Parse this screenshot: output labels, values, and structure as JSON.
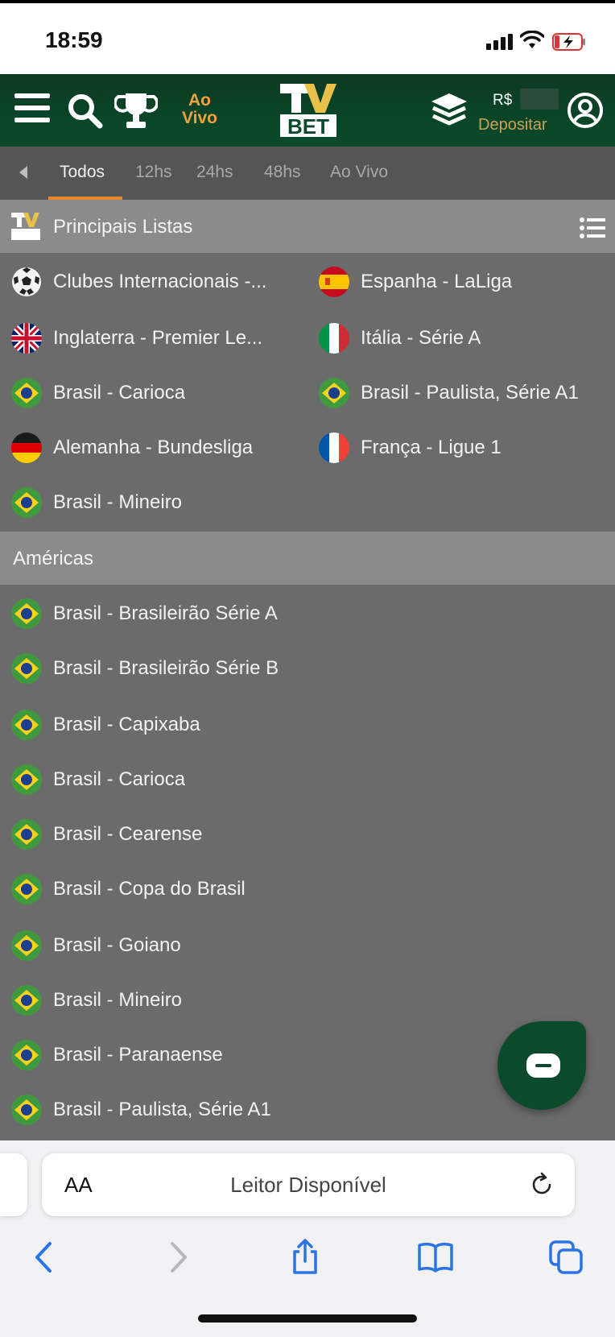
{
  "status_bar": {
    "time": "18:59"
  },
  "header": {
    "live_label": "Ao Vivo",
    "logo_text_top": "TV",
    "logo_text_bottom": "BET",
    "currency": "R$",
    "deposit_label": "Depositar"
  },
  "tabs": [
    {
      "label": "Todos",
      "active": true
    },
    {
      "label": "12hs",
      "active": false
    },
    {
      "label": "24hs",
      "active": false
    },
    {
      "label": "48hs",
      "active": false
    },
    {
      "label": "Ao Vivo",
      "active": false
    }
  ],
  "main_lists": {
    "title": "Principais Listas",
    "items": [
      {
        "label": "Clubes Internacionais -...",
        "icon": "soccer-ball-icon"
      },
      {
        "label": "Espanha - LaLiga",
        "icon": "spain-flag-icon"
      },
      {
        "label": "Inglaterra - Premier Le...",
        "icon": "uk-flag-icon"
      },
      {
        "label": "Itália - Série A",
        "icon": "italy-flag-icon"
      },
      {
        "label": "Brasil - Carioca",
        "icon": "brazil-flag-icon"
      },
      {
        "label": "Brasil - Paulista, Série A1",
        "icon": "brazil-flag-icon"
      },
      {
        "label": "Alemanha - Bundesliga",
        "icon": "germany-flag-icon"
      },
      {
        "label": "França - Ligue 1",
        "icon": "france-flag-icon"
      },
      {
        "label": "Brasil - Mineiro",
        "icon": "brazil-flag-icon"
      }
    ]
  },
  "americas": {
    "title": "Américas",
    "items": [
      {
        "label": "Brasil - Brasileirão Série A",
        "icon": "brazil-flag-icon"
      },
      {
        "label": "Brasil - Brasileirão Série B",
        "icon": "brazil-flag-icon"
      },
      {
        "label": "Brasil - Capixaba",
        "icon": "brazil-flag-icon"
      },
      {
        "label": "Brasil - Carioca",
        "icon": "brazil-flag-icon"
      },
      {
        "label": "Brasil - Cearense",
        "icon": "brazil-flag-icon"
      },
      {
        "label": "Brasil - Copa do Brasil",
        "icon": "brazil-flag-icon"
      },
      {
        "label": "Brasil - Goiano",
        "icon": "brazil-flag-icon"
      },
      {
        "label": "Brasil - Mineiro",
        "icon": "brazil-flag-icon"
      },
      {
        "label": "Brasil - Paranaense",
        "icon": "brazil-flag-icon"
      },
      {
        "label": "Brasil - Paulista, Série A1",
        "icon": "brazil-flag-icon"
      }
    ]
  },
  "browser": {
    "text_size_label": "AA",
    "reader_text": "Leitor Disponível"
  }
}
